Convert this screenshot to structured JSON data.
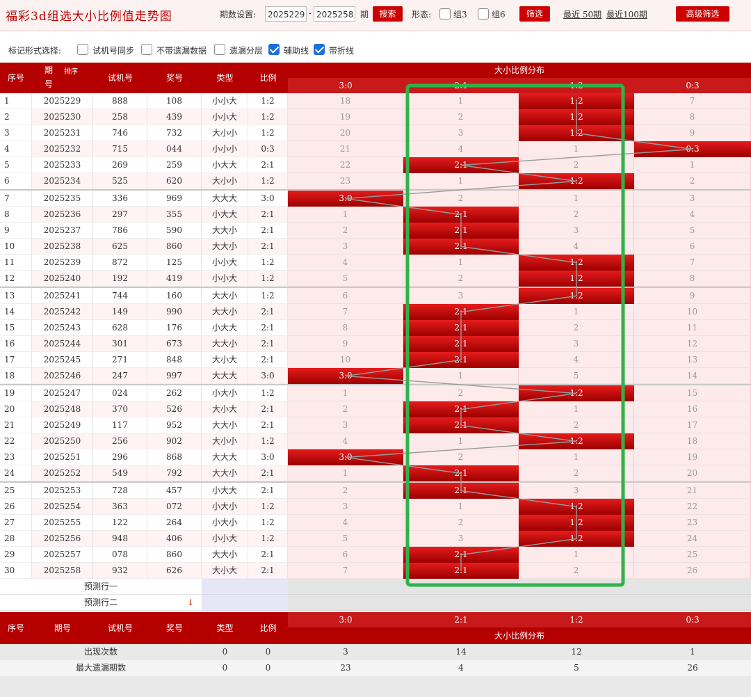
{
  "app": {
    "title": "福彩3d组选大小比例值走势图"
  },
  "toolbar": {
    "period_label": "期数设置:",
    "start": "2025229",
    "dash": "-",
    "end": "2025258",
    "qi": "期",
    "search_label": "搜索",
    "form_label": "形态:",
    "zu3": "组3",
    "zu6": "组6",
    "filter_label": "筛选",
    "recent50": "最近 50期",
    "recent100": "最近100期",
    "advanced": "高级筛选"
  },
  "marks": {
    "label": "标记形式选择:",
    "options": [
      {
        "label": "试机号同步",
        "checked": false
      },
      {
        "label": "不带遗漏数据",
        "checked": false
      },
      {
        "label": "遗漏分层",
        "checked": false
      },
      {
        "label": "辅助线",
        "checked": true
      },
      {
        "label": "带折线",
        "checked": true
      }
    ]
  },
  "table": {
    "headers": {
      "seq": "序号",
      "issue_top": "期",
      "issue_bottom": "号",
      "sort": "排序",
      "trial": "试机号",
      "prize": "奖号",
      "type": "类型",
      "ratio": "比例",
      "dist": "大小比例分布",
      "issue": "期号"
    },
    "dist_cols": [
      "3:0",
      "2:1",
      "1:2",
      "0:3"
    ],
    "rows": [
      {
        "seq": "1",
        "issue": "2025229",
        "trial": "888",
        "prize": "108",
        "type": "小小大",
        "ratio": "1:2",
        "dist": [
          "18",
          "1",
          "1:2",
          "7"
        ],
        "hit": 2
      },
      {
        "seq": "2",
        "issue": "2025230",
        "trial": "258",
        "prize": "439",
        "type": "小小大",
        "ratio": "1:2",
        "dist": [
          "19",
          "2",
          "1:2",
          "8"
        ],
        "hit": 2
      },
      {
        "seq": "3",
        "issue": "2025231",
        "trial": "746",
        "prize": "732",
        "type": "大小小",
        "ratio": "1:2",
        "dist": [
          "20",
          "3",
          "1:2",
          "9"
        ],
        "hit": 2
      },
      {
        "seq": "4",
        "issue": "2025232",
        "trial": "715",
        "prize": "044",
        "type": "小小小",
        "ratio": "0:3",
        "dist": [
          "21",
          "4",
          "1",
          "0:3"
        ],
        "hit": 3
      },
      {
        "seq": "5",
        "issue": "2025233",
        "trial": "269",
        "prize": "259",
        "type": "小大大",
        "ratio": "2:1",
        "dist": [
          "22",
          "2:1",
          "2",
          "1"
        ],
        "hit": 1
      },
      {
        "seq": "6",
        "issue": "2025234",
        "trial": "525",
        "prize": "620",
        "type": "大小小",
        "ratio": "1:2",
        "dist": [
          "23",
          "1",
          "1:2",
          "2"
        ],
        "hit": 2
      },
      {
        "seq": "7",
        "issue": "2025235",
        "trial": "336",
        "prize": "969",
        "type": "大大大",
        "ratio": "3:0",
        "dist": [
          "3:0",
          "2",
          "1",
          "3"
        ],
        "hit": 0
      },
      {
        "seq": "8",
        "issue": "2025236",
        "trial": "297",
        "prize": "355",
        "type": "小大大",
        "ratio": "2:1",
        "dist": [
          "1",
          "2:1",
          "2",
          "4"
        ],
        "hit": 1
      },
      {
        "seq": "9",
        "issue": "2025237",
        "trial": "786",
        "prize": "590",
        "type": "大大小",
        "ratio": "2:1",
        "dist": [
          "2",
          "2:1",
          "3",
          "5"
        ],
        "hit": 1
      },
      {
        "seq": "10",
        "issue": "2025238",
        "trial": "625",
        "prize": "860",
        "type": "大大小",
        "ratio": "2:1",
        "dist": [
          "3",
          "2:1",
          "4",
          "6"
        ],
        "hit": 1
      },
      {
        "seq": "11",
        "issue": "2025239",
        "trial": "872",
        "prize": "125",
        "type": "小小大",
        "ratio": "1:2",
        "dist": [
          "4",
          "1",
          "1:2",
          "7"
        ],
        "hit": 2
      },
      {
        "seq": "12",
        "issue": "2025240",
        "trial": "192",
        "prize": "419",
        "type": "小小大",
        "ratio": "1:2",
        "dist": [
          "5",
          "2",
          "1:2",
          "8"
        ],
        "hit": 2
      },
      {
        "seq": "13",
        "issue": "2025241",
        "trial": "744",
        "prize": "160",
        "type": "大大小",
        "ratio": "1:2",
        "dist": [
          "6",
          "3",
          "1:2",
          "9"
        ],
        "hit": 2
      },
      {
        "seq": "14",
        "issue": "2025242",
        "trial": "149",
        "prize": "990",
        "type": "大大小",
        "ratio": "2:1",
        "dist": [
          "7",
          "2:1",
          "1",
          "10"
        ],
        "hit": 1
      },
      {
        "seq": "15",
        "issue": "2025243",
        "trial": "628",
        "prize": "176",
        "type": "小大大",
        "ratio": "2:1",
        "dist": [
          "8",
          "2:1",
          "2",
          "11"
        ],
        "hit": 1
      },
      {
        "seq": "16",
        "issue": "2025244",
        "trial": "301",
        "prize": "673",
        "type": "大大小",
        "ratio": "2:1",
        "dist": [
          "9",
          "2:1",
          "3",
          "12"
        ],
        "hit": 1
      },
      {
        "seq": "17",
        "issue": "2025245",
        "trial": "271",
        "prize": "848",
        "type": "大小大",
        "ratio": "2:1",
        "dist": [
          "10",
          "2:1",
          "4",
          "13"
        ],
        "hit": 1
      },
      {
        "seq": "18",
        "issue": "2025246",
        "trial": "247",
        "prize": "997",
        "type": "大大大",
        "ratio": "3:0",
        "dist": [
          "3:0",
          "1",
          "5",
          "14"
        ],
        "hit": 0
      },
      {
        "seq": "19",
        "issue": "2025247",
        "trial": "024",
        "prize": "262",
        "type": "小大小",
        "ratio": "1:2",
        "dist": [
          "1",
          "2",
          "1:2",
          "15"
        ],
        "hit": 2
      },
      {
        "seq": "20",
        "issue": "2025248",
        "trial": "370",
        "prize": "526",
        "type": "大小大",
        "ratio": "2:1",
        "dist": [
          "2",
          "2:1",
          "1",
          "16"
        ],
        "hit": 1
      },
      {
        "seq": "21",
        "issue": "2025249",
        "trial": "117",
        "prize": "952",
        "type": "大大小",
        "ratio": "2:1",
        "dist": [
          "3",
          "2:1",
          "2",
          "17"
        ],
        "hit": 1
      },
      {
        "seq": "22",
        "issue": "2025250",
        "trial": "256",
        "prize": "902",
        "type": "大小小",
        "ratio": "1:2",
        "dist": [
          "4",
          "1",
          "1:2",
          "18"
        ],
        "hit": 2
      },
      {
        "seq": "23",
        "issue": "2025251",
        "trial": "296",
        "prize": "868",
        "type": "大大大",
        "ratio": "3:0",
        "dist": [
          "3:0",
          "2",
          "1",
          "19"
        ],
        "hit": 0
      },
      {
        "seq": "24",
        "issue": "2025252",
        "trial": "549",
        "prize": "792",
        "type": "大大小",
        "ratio": "2:1",
        "dist": [
          "1",
          "2:1",
          "2",
          "20"
        ],
        "hit": 1
      },
      {
        "seq": "25",
        "issue": "2025253",
        "trial": "728",
        "prize": "457",
        "type": "小大大",
        "ratio": "2:1",
        "dist": [
          "2",
          "2:1",
          "3",
          "21"
        ],
        "hit": 1
      },
      {
        "seq": "26",
        "issue": "2025254",
        "trial": "363",
        "prize": "072",
        "type": "小大小",
        "ratio": "1:2",
        "dist": [
          "3",
          "1",
          "1:2",
          "22"
        ],
        "hit": 2
      },
      {
        "seq": "27",
        "issue": "2025255",
        "trial": "122",
        "prize": "264",
        "type": "小大小",
        "ratio": "1:2",
        "dist": [
          "4",
          "2",
          "1:2",
          "23"
        ],
        "hit": 2
      },
      {
        "seq": "28",
        "issue": "2025256",
        "trial": "948",
        "prize": "406",
        "type": "小小大",
        "ratio": "1:2",
        "dist": [
          "5",
          "3",
          "1:2",
          "24"
        ],
        "hit": 2
      },
      {
        "seq": "29",
        "issue": "2025257",
        "trial": "078",
        "prize": "860",
        "type": "大大小",
        "ratio": "2:1",
        "dist": [
          "6",
          "2:1",
          "1",
          "25"
        ],
        "hit": 1
      },
      {
        "seq": "30",
        "issue": "2025258",
        "trial": "932",
        "prize": "626",
        "type": "大小大",
        "ratio": "2:1",
        "dist": [
          "7",
          "2:1",
          "2",
          "26"
        ],
        "hit": 1
      }
    ],
    "predict": [
      "预测行一",
      "预测行二"
    ],
    "stats": [
      {
        "label": "出现次数",
        "type": "0",
        "ratio": "0",
        "dist": [
          "3",
          "14",
          "12",
          "1"
        ]
      },
      {
        "label": "最大遗漏期数",
        "type": "0",
        "ratio": "0",
        "dist": [
          "23",
          "4",
          "5",
          "26"
        ]
      }
    ]
  },
  "colors": {
    "accent": "#c00000",
    "highlight_box": "#2db34a"
  }
}
